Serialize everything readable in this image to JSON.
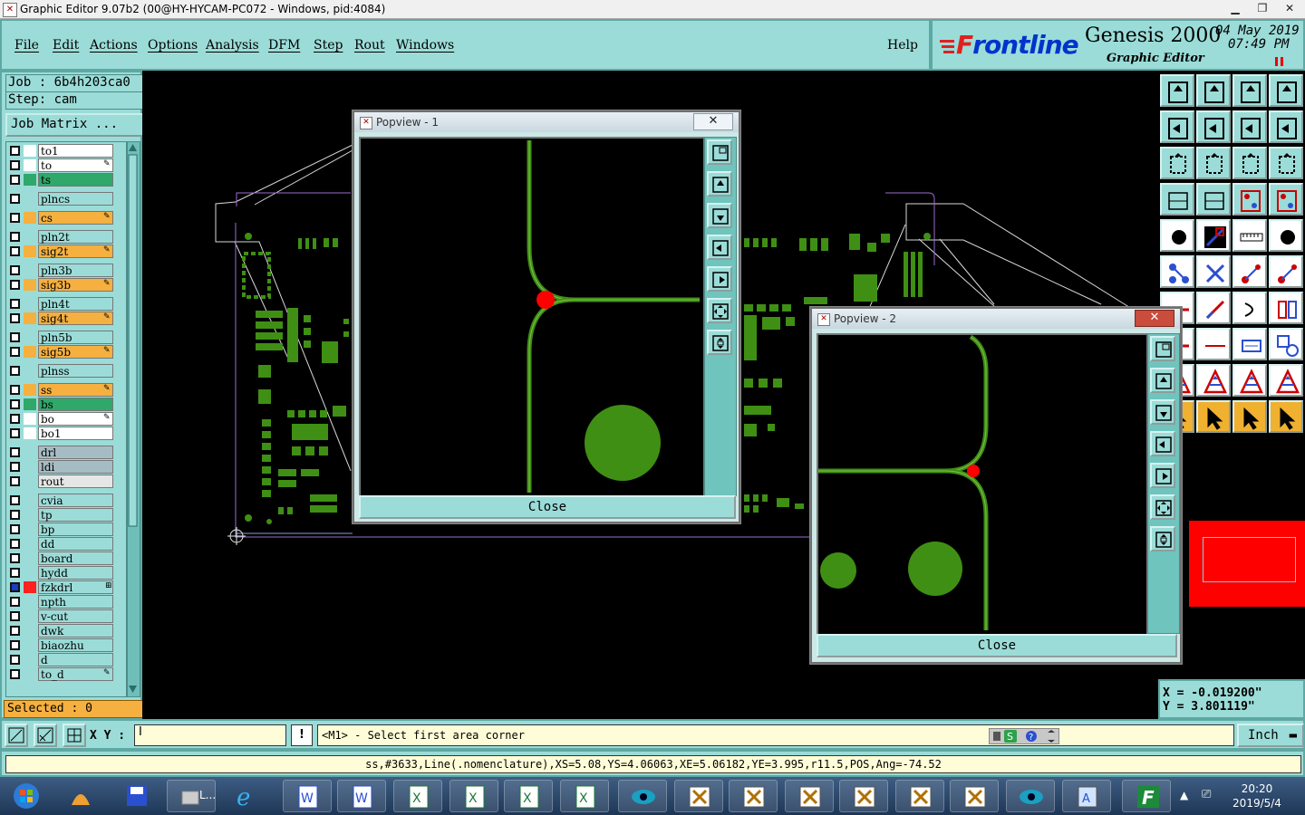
{
  "window": {
    "title": "Graphic Editor 9.07b2 (00@HY-HYCAM-PC072 - Windows, pid:4084)"
  },
  "menu": [
    "File",
    "Edit",
    "Actions",
    "Options",
    "Analysis",
    "DFM",
    "Step",
    "Rout",
    "Windows"
  ],
  "help": "Help",
  "brand": {
    "logo_f": "F",
    "logo_rest": "rontline",
    "product": "Genesis 2000",
    "subtitle": "Graphic Editor",
    "date_line": "04 May 2019",
    "time_line": "07:49 PM"
  },
  "job": {
    "job_line": "Job : 6b4h203ca0",
    "step_line": "Step: cam",
    "matrix_button": "Job Matrix ..."
  },
  "layers": [
    {
      "name": "to1",
      "color": "#ffffff",
      "edit": false,
      "group": 0
    },
    {
      "name": "to",
      "color": "#ffffff",
      "edit": true,
      "group": 0
    },
    {
      "name": "ts",
      "color": "#2fa86a",
      "edit": false,
      "group": 0
    },
    {
      "name": "plncs",
      "color": "#9bdcd8",
      "edit": false,
      "group": 1
    },
    {
      "name": "cs",
      "color": "#f5b040",
      "edit": true,
      "group": 2
    },
    {
      "name": "pln2t",
      "color": "#9bdcd8",
      "edit": false,
      "group": 3
    },
    {
      "name": "sig2t",
      "color": "#f5b040",
      "edit": true,
      "group": 3
    },
    {
      "name": "pln3b",
      "color": "#9bdcd8",
      "edit": false,
      "group": 4
    },
    {
      "name": "sig3b",
      "color": "#f5b040",
      "edit": true,
      "group": 4
    },
    {
      "name": "pln4t",
      "color": "#9bdcd8",
      "edit": false,
      "group": 5
    },
    {
      "name": "sig4t",
      "color": "#f5b040",
      "edit": true,
      "group": 5
    },
    {
      "name": "pln5b",
      "color": "#9bdcd8",
      "edit": false,
      "group": 6
    },
    {
      "name": "sig5b",
      "color": "#f5b040",
      "edit": true,
      "group": 6
    },
    {
      "name": "plnss",
      "color": "#9bdcd8",
      "edit": false,
      "group": 7
    },
    {
      "name": "ss",
      "color": "#f5b040",
      "edit": true,
      "group": 8
    },
    {
      "name": "bs",
      "color": "#2fa86a",
      "edit": false,
      "group": 8
    },
    {
      "name": "bo",
      "color": "#ffffff",
      "edit": true,
      "group": 8
    },
    {
      "name": "bo1",
      "color": "#ffffff",
      "edit": false,
      "group": 8
    },
    {
      "name": "drl",
      "color": "#a6bcc4",
      "edit": false,
      "group": 9
    },
    {
      "name": "ldi",
      "color": "#a6bcc4",
      "edit": false,
      "group": 9
    },
    {
      "name": "rout",
      "color": "#e6e6e6",
      "edit": false,
      "group": 9
    },
    {
      "name": "cvia",
      "color": "#9bdcd8",
      "edit": false,
      "group": 10
    },
    {
      "name": "tp",
      "color": "#9bdcd8",
      "edit": false,
      "group": 10
    },
    {
      "name": "bp",
      "color": "#9bdcd8",
      "edit": false,
      "group": 10
    },
    {
      "name": "dd",
      "color": "#9bdcd8",
      "edit": false,
      "group": 10
    },
    {
      "name": "board",
      "color": "#9bdcd8",
      "edit": false,
      "group": 10
    },
    {
      "name": "hydd",
      "color": "#9bdcd8",
      "edit": false,
      "group": 10
    },
    {
      "name": "fzkdrl",
      "color": "#9bdcd8",
      "edit": false,
      "group": 10,
      "affected": true
    },
    {
      "name": "npth",
      "color": "#9bdcd8",
      "edit": false,
      "group": 10
    },
    {
      "name": "v-cut",
      "color": "#9bdcd8",
      "edit": false,
      "group": 10
    },
    {
      "name": "dwk",
      "color": "#9bdcd8",
      "edit": false,
      "group": 10
    },
    {
      "name": "biaozhu",
      "color": "#9bdcd8",
      "edit": false,
      "group": 10
    },
    {
      "name": "d",
      "color": "#9bdcd8",
      "edit": false,
      "group": 10
    },
    {
      "name": "to_d",
      "color": "#9bdcd8",
      "edit": true,
      "group": 10
    }
  ],
  "selected_text": "Selected : 0",
  "popview1": {
    "title": "Popview - 1",
    "close_label": "Close"
  },
  "popview2": {
    "title": "Popview - 2",
    "close_label": "Close"
  },
  "coords": {
    "x_line": "X = -0.019200\"",
    "y_line": "Y = 3.801119\""
  },
  "command": {
    "xy_label": "X Y :",
    "xy_value": "",
    "prompt": "<M1> - Select first area corner",
    "unit": "Inch",
    "warn": "!"
  },
  "status_line": "ss,#3633,Line(.nomenclature),XS=5.08,YS=4.06063,XE=5.06182,YE=3.995,r11.5,POS,Ang=-74.52",
  "taskbar": {
    "time": "20:20",
    "date": "2019/5/4",
    "app_label": "L..."
  },
  "colors": {
    "accent_teal": "#9bdcd8",
    "pcb_green": "#3f8f14",
    "highlight_red": "#ff0000",
    "edit_orange": "#f5b040"
  }
}
